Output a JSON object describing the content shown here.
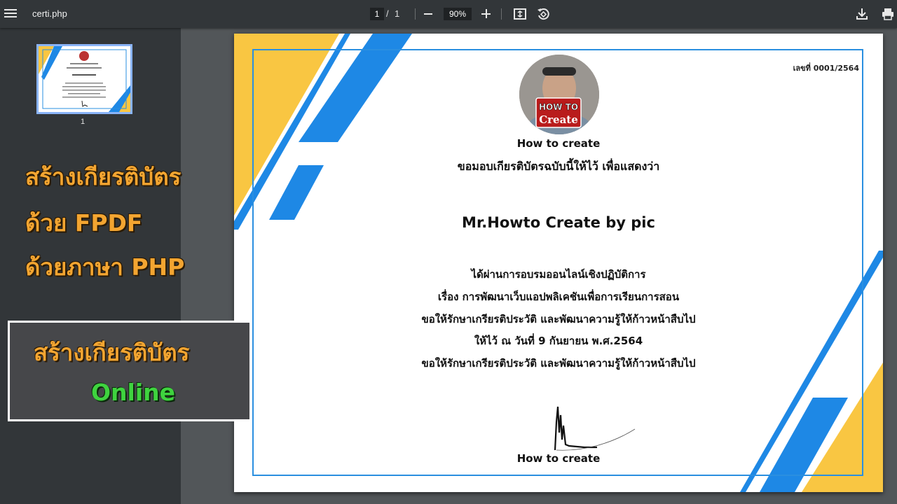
{
  "toolbar": {
    "title": "certi.php",
    "current_page": "1",
    "page_separator": "/",
    "total_pages": "1",
    "zoom": "90%"
  },
  "sidebar": {
    "thumbnail_number": "1"
  },
  "overlay": {
    "line1": "สร้างเกียรติบัตร",
    "line2": "ด้วย FPDF",
    "line3": "ด้วยภาษา PHP",
    "box_line1": "สร้างเกียรติบัตร",
    "box_line2": "Online"
  },
  "certificate": {
    "cert_number": "เลขที่ 0001/2564",
    "logo_text_top": "HOW TO",
    "logo_text_bottom": "Create",
    "org_name": "How to create",
    "award_line": "ขอมอบเกียรติบัตรฉบับนี้ให้ไว้ เพื่อแสดงว่า",
    "recipient": "Mr.Howto  Create by pic",
    "line_training": "ได้ผ่านการอบรมออนไลน์เชิงปฏิบัติการ",
    "line_subject": "เรื่อง  การพัฒนาเว็บแอปพลิเคชันเพื่อการเรียนการสอน",
    "line_wish1": "ขอให้รักษาเกรียรติประวัติ  และพัฒนาความรู้ให้ก้าวหน้าสืบไป",
    "line_date": "ให้ไว้  ณ  วันที่ 9 กันยายน พ.ศ.2564",
    "line_wish2": "ขอให้รักษาเกรียรติประวัติ  และพัฒนาความรู้ให้ก้าวหน้าสืบไป",
    "signature_name": "How to create"
  },
  "colors": {
    "accent_blue": "#1e88e5",
    "accent_yellow": "#f9c642",
    "overlay_orange": "#f3a531",
    "overlay_green": "#3fd33f"
  }
}
